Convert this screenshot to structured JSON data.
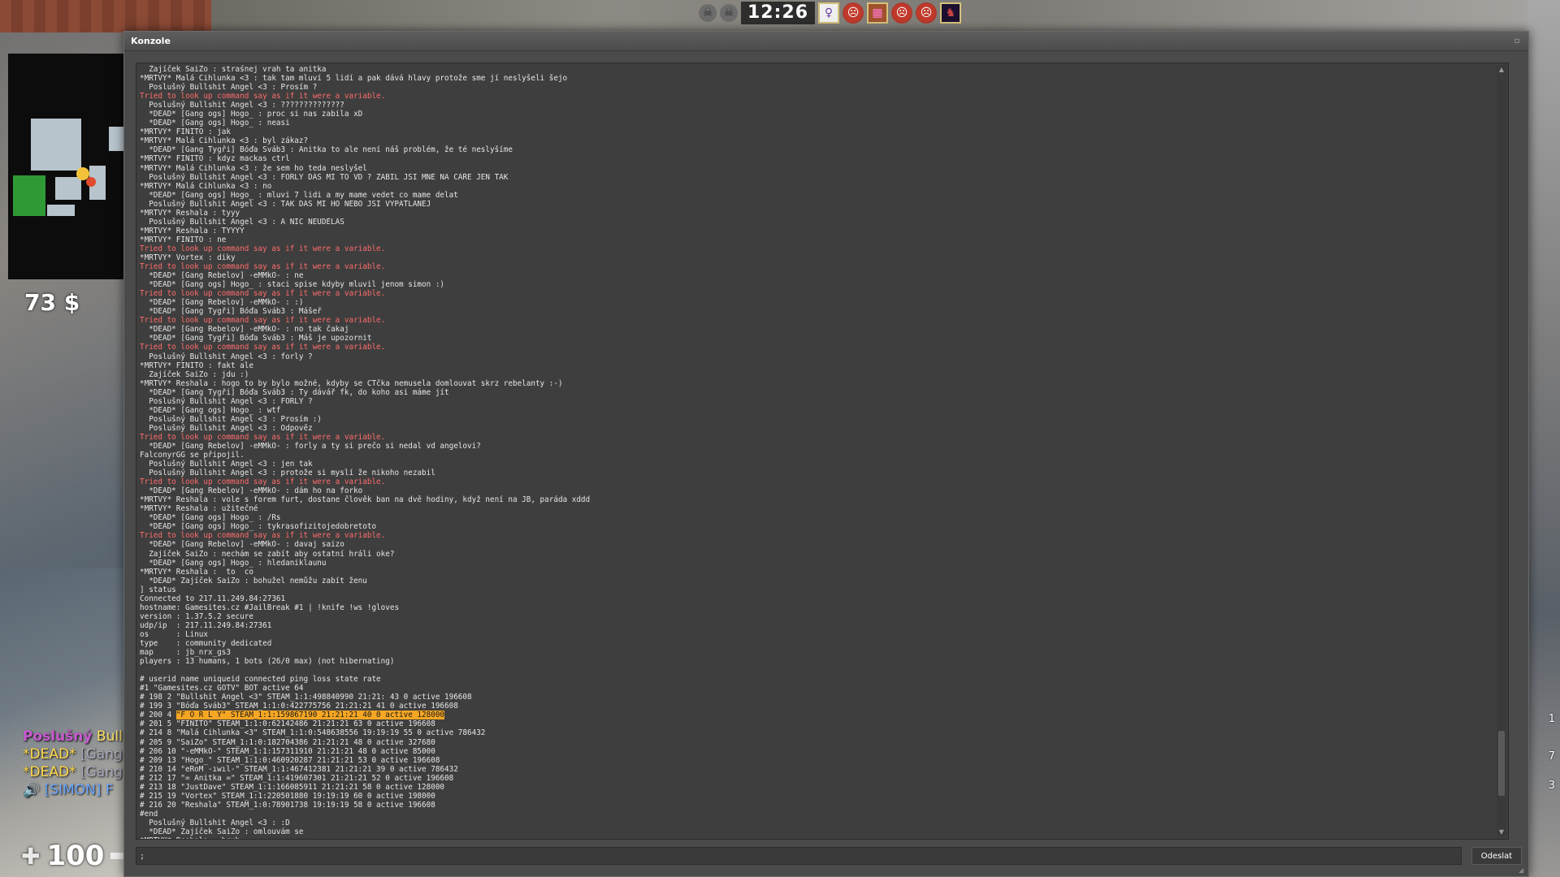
{
  "hud": {
    "timer": "12:26",
    "money": "73 $",
    "health": "100",
    "right_numbers": [
      "1",
      "7",
      "3"
    ],
    "killfeed": [
      {
        "prefix": "Poslušný",
        "name": "Bullshit"
      },
      {
        "prefix": "*DEAD*",
        "name": "[Gang og"
      },
      {
        "prefix": "*DEAD*",
        "name": "[Gang og"
      },
      {
        "prefix": "",
        "name": "[SIMON] F"
      }
    ]
  },
  "console": {
    "title": "Konzole",
    "submit_label": "Odeslat",
    "input_value": ";",
    "lines": [
      {
        "t": "  Zajíček SaiZo : straśnej vrah ta anitka",
        "c": "n"
      },
      {
        "t": "*MRTVÝ* Malá Cihlunka <3 : tak tam mluví 5 lidí a pak dává hlavy protože sme jí neslyšeli šejo",
        "c": "n"
      },
      {
        "t": "  Poslušný Bullshit Angel <3 : Prosím ?",
        "c": "n"
      },
      {
        "t": "Tried to look up command say as if it were a variable.",
        "c": "e"
      },
      {
        "t": "  Poslušný Bullshit Angel <3 : ??????????????",
        "c": "n"
      },
      {
        "t": "  *DEAD* [Gang ogs] Hogo_ : proc si nas zabila xD",
        "c": "n"
      },
      {
        "t": "  *DEAD* [Gang ogs] Hogo_ : neasi",
        "c": "n"
      },
      {
        "t": "*MRTVÝ* FINITO : jak",
        "c": "n"
      },
      {
        "t": "*MRTVÝ* Malá Cihlunka <3 : byl zákaz?",
        "c": "n"
      },
      {
        "t": "  *DEAD* [Gang Tygři] Bóďa Šváb3 : Anitka to ale není náš problém, že té neslyšíme",
        "c": "n"
      },
      {
        "t": "*MRTVÝ* FINITO : kdyz mackas ctrl",
        "c": "n"
      },
      {
        "t": "*MRTVÝ* Malá Cihlunka <3 : že sem ho teda neslyšel",
        "c": "n"
      },
      {
        "t": "  Poslušný Bullshit Angel <3 : FORLY DÁŠ MI TO VD ? ZABIL JSI MNĚ NA ČÁŘE JEN TAK",
        "c": "n"
      },
      {
        "t": "*MRTVÝ* Malá Cihlunka <3 : no",
        "c": "n"
      },
      {
        "t": "  *DEAD* [Gang ogs] Hogo_ : mluvi 7 lidi a my mame vedet co mame delat",
        "c": "n"
      },
      {
        "t": "  Poslušný Bullshit Angel <3 : TAK DÁŠ MI HO NEBO JSI VYPATLANEJ",
        "c": "n"
      },
      {
        "t": "*MRTVÝ* Reshala : tyyy",
        "c": "n"
      },
      {
        "t": "  Poslušný Bullshit Angel <3 : A NIC NEUDĚLÁŠ",
        "c": "n"
      },
      {
        "t": "*MRTVÝ* Reshala : TYYYY",
        "c": "n"
      },
      {
        "t": "*MRTVÝ* FINITO : ne",
        "c": "n"
      },
      {
        "t": "Tried to look up command say as if it were a variable.",
        "c": "e"
      },
      {
        "t": "*MRTVÝ* Vortex : diky",
        "c": "n"
      },
      {
        "t": "Tried to look up command say as if it were a variable.",
        "c": "e"
      },
      {
        "t": "  *DEAD* [Gang Rebelov] -eMMkO- : ne",
        "c": "n"
      },
      {
        "t": "  *DEAD* [Gang ogs] Hogo_ : staci spise kdyby mluvil jenom simon :)",
        "c": "n"
      },
      {
        "t": "Tried to look up command say as if it were a variable.",
        "c": "e"
      },
      {
        "t": "  *DEAD* [Gang Rebelov] -eMMkO- : :)",
        "c": "n"
      },
      {
        "t": "  *DEAD* [Gang Tygři] Bóďa Šváb3 : Mášeř",
        "c": "n"
      },
      {
        "t": "Tried to look up command say as if it were a variable.",
        "c": "e"
      },
      {
        "t": "  *DEAD* [Gang Rebelov] -eMMkO- : no tak čakaj",
        "c": "n"
      },
      {
        "t": "  *DEAD* [Gang Tygři] Bóďa Šváb3 : Máš je upozornit",
        "c": "n"
      },
      {
        "t": "Tried to look up command say as if it were a variable.",
        "c": "e"
      },
      {
        "t": "  Poslušný Bullshit Angel <3 : forly ?",
        "c": "n"
      },
      {
        "t": "*MRTVÝ* FINITO : fakt ale",
        "c": "n"
      },
      {
        "t": "  Zajíček SaiZo : jdu :)",
        "c": "n"
      },
      {
        "t": "*MRTVÝ* Reshala : hogo to by bylo možné, kdyby se CTčka nemusela domlouvat skrz rebelanty :-)",
        "c": "n"
      },
      {
        "t": "  *DEAD* [Gang Tygři] Bóďa Šváb3 : Ty dávář fk, do koho asi máme jít",
        "c": "n"
      },
      {
        "t": "  Poslušný Bullshit Angel <3 : FORLY ?",
        "c": "n"
      },
      {
        "t": "  *DEAD* [Gang ogs] Hogo_ : wtf",
        "c": "n"
      },
      {
        "t": "  Poslušný Bullshit Angel <3 : Prosím :)",
        "c": "n"
      },
      {
        "t": "  Poslušný Bullshit Angel <3 : Odpověz",
        "c": "n"
      },
      {
        "t": "Tried to look up command say as if it were a variable.",
        "c": "e"
      },
      {
        "t": "  *DEAD* [Gang Rebelov] -eMMkO- : forly a ty si prečo si nedal vd angelovi?",
        "c": "n"
      },
      {
        "t": "FalconyrGG se připojil.",
        "c": "n"
      },
      {
        "t": "  Poslušný Bullshit Angel <3 : jen tak",
        "c": "n"
      },
      {
        "t": "  Poslušný Bullshit Angel <3 : protože si myslí že nikoho nezabil",
        "c": "n"
      },
      {
        "t": "Tried to look up command say as if it were a variable.",
        "c": "e"
      },
      {
        "t": "  *DEAD* [Gang Rebelov] -eMMkO- : dám ho na forko",
        "c": "n"
      },
      {
        "t": "*MRTVÝ* Reshala : vole s forem furt, dostane člověk ban na dvě hodiny, když není na JB, paráda xddd",
        "c": "n"
      },
      {
        "t": "*MRTVÝ* Reshala : užitečné",
        "c": "n"
      },
      {
        "t": "  *DEAD* [Gang ogs] Hogo_ : /Rs",
        "c": "n"
      },
      {
        "t": "  *DEAD* [Gang ogs] Hogo_ : tykrasofizitojedobretoto",
        "c": "n"
      },
      {
        "t": "Tried to look up command say as if it were a variable.",
        "c": "e"
      },
      {
        "t": "  *DEAD* [Gang Rebelov] -eMMkO- : davaj saizo",
        "c": "n"
      },
      {
        "t": "  Zajíček SaiZo : nechám se zabít aby ostatní hráli oke?",
        "c": "n"
      },
      {
        "t": "  *DEAD* [Gang ogs] Hogo_ : hledaniklaunu",
        "c": "n"
      },
      {
        "t": "*MRTVÝ* Reshala :  to  co",
        "c": "n"
      },
      {
        "t": "  *DEAD* Zajíček SaiZo : bohužel nemůžu zabít ženu",
        "c": "n"
      },
      {
        "t": "] status",
        "c": "n"
      },
      {
        "t": "Connected to 217.11.249.84:27361",
        "c": "n"
      },
      {
        "t": "hostname: Gamesites.cz #JailBreak #1 | !knife !ws !gloves",
        "c": "n"
      },
      {
        "t": "version : 1.37.5.2 secure",
        "c": "n"
      },
      {
        "t": "udp/ip  : 217.11.249.84:27361",
        "c": "n"
      },
      {
        "t": "os      : Linux",
        "c": "n"
      },
      {
        "t": "type    : community dedicated",
        "c": "n"
      },
      {
        "t": "map     : jb_nrx_gs3",
        "c": "n"
      },
      {
        "t": "players : 13 humans, 1 bots (26/0 max) (not hibernating)",
        "c": "n"
      },
      {
        "t": "",
        "c": "n"
      },
      {
        "t": "# userid name uniqueid connected ping loss state rate",
        "c": "n"
      },
      {
        "t": "#1 \"Gamesites.cz GOTV\" BOT active 64",
        "c": "n"
      },
      {
        "t": "# 198 2 \"Bullshit Angel <3\" STEAM_1:1:498840990 21:21: 43 0 active 196608",
        "c": "n"
      },
      {
        "t": "# 199 3 \"Bóďa Šváb3\" STEAM_1:1:0:422775756 21:21:21 41 0 active 196608",
        "c": "n"
      },
      {
        "t": "# 200 4 ",
        "c": "h",
        "h": "\"F O R L Y\" STEAM_1:1:159867190 21:21:21 40 0 active 128000"
      },
      {
        "t": "# 201 5 \"FINITO\" STEAM_1:1:0:62142486 21:21:21 63 0 active 196608",
        "c": "n"
      },
      {
        "t": "# 214 8 \"Malá Cihlunka <3\" STEAM_1:1:0:548638556 19:19:19 55 0 active 786432",
        "c": "n"
      },
      {
        "t": "# 205 9 \"SaiZo\" STEAM_1:1:0:182704386 21:21:21 48 0 active 327680",
        "c": "n"
      },
      {
        "t": "# 206 10 \"-eMMkO-\" STEAM_1:1:157311910 21:21:21 48 0 active 85000",
        "c": "n"
      },
      {
        "t": "# 209 13 \"Hogo_\" STEAM_1:1:0:460920287 21:21:21 53 0 active 196608",
        "c": "n"
      },
      {
        "t": "# 210 14 \"eRoM -ıwıl-\" STEAM_1:1:467412381 21:21:21 39 0 active 786432",
        "c": "n"
      },
      {
        "t": "# 212 17 \"= Anitka =\" STEAM_1:1:419607301 21:21:21 52 0 active 196608",
        "c": "n"
      },
      {
        "t": "# 213 18 \"JustDave\" STEAM_1:1:166085911 21:21:21 58 0 active 128000",
        "c": "n"
      },
      {
        "t": "# 215 19 \"Vortex\" STEAM_1:1:220501880 19:19:19 60 0 active 198000",
        "c": "n"
      },
      {
        "t": "# 216 20 \"Reshala\" STEAM_1:0:78901738 19:19:19 58 0 active 196608",
        "c": "n"
      },
      {
        "t": "#end",
        "c": "n"
      },
      {
        "t": "  Poslušný Bullshit Angel <3 : :D",
        "c": "n"
      },
      {
        "t": "  *DEAD* Zajíček SaiZo : omlouvám se",
        "c": "n"
      },
      {
        "t": "*MRTVÝ* Reshala : bruh",
        "c": "n"
      }
    ]
  }
}
